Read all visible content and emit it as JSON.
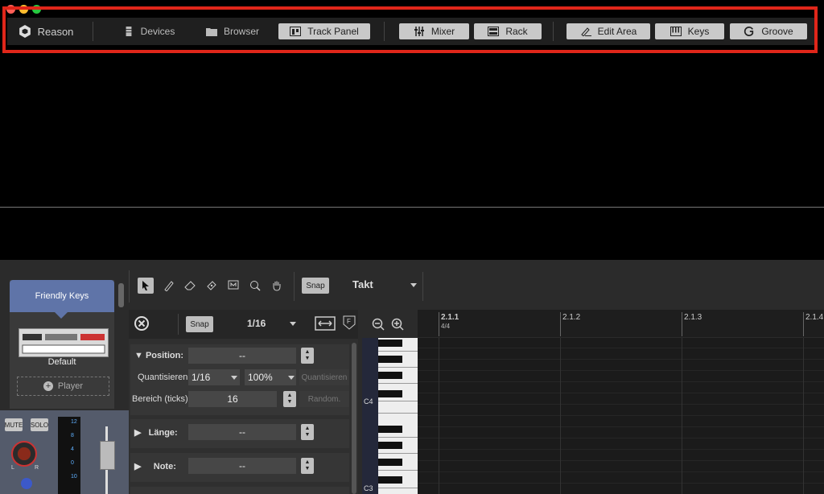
{
  "toolbar": {
    "logo_label": "Reason",
    "devices_label": "Devices",
    "browser_label": "Browser",
    "track_panel_label": "Track Panel",
    "mixer_label": "Mixer",
    "rack_label": "Rack",
    "edit_area_label": "Edit Area",
    "keys_label": "Keys",
    "groove_label": "Groove"
  },
  "device": {
    "title": "Friendly Keys",
    "patch_name": "Default",
    "player_label": "Player"
  },
  "channel": {
    "mute_label": "MUTE",
    "solo_label": "SOLO",
    "knob_l": "L",
    "knob_r": "R",
    "meter_scale": [
      "12",
      "8",
      "4",
      "0",
      "10"
    ]
  },
  "editor_toolbar": {
    "snap_label": "Snap",
    "snap_value": "Takt"
  },
  "inspector": {
    "snap_label": "Snap",
    "grid_value": "1/16",
    "position_label": "Position:",
    "position_value": "--",
    "quant_label": "Quantisieren",
    "quant_value": "1/16",
    "quant_amount": "100%",
    "quant_button": "Quantisieren",
    "range_label": "Bereich (ticks)",
    "range_value": "16",
    "random_button": "Random.",
    "length_label": "Länge:",
    "length_value": "--",
    "note_label": "Note:",
    "note_value": "--"
  },
  "ruler": {
    "marks": [
      "2.1.1",
      "2.1.2",
      "2.1.3",
      "2.1.4"
    ],
    "signature": "4/4"
  },
  "piano": {
    "c4_label": "C4",
    "c3_label": "C3"
  },
  "colors": {
    "highlight_frame": "#e0261a",
    "device_header": "#5f74a8"
  }
}
